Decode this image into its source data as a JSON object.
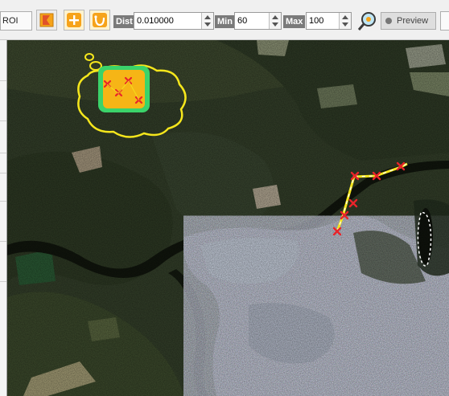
{
  "toolbar": {
    "roi_label": "ROI",
    "dist": {
      "label": "Dist",
      "value": "0.010000"
    },
    "min": {
      "label": "Min",
      "value": "60"
    },
    "max": {
      "label": "Max",
      "value": "100"
    },
    "preview_label": "Preview"
  },
  "icons": {
    "draw_roi": "orange-flag-roi-icon",
    "add": "plus-icon",
    "lasso": "lasso-icon",
    "zoom": "magnifier-zoom-icon",
    "preview": "radio-dot-icon",
    "thought_bubble": "thought-bubble-icon",
    "point_set": "x-points-icon"
  },
  "colors": {
    "accent_orange": "#f6a31a",
    "toolbar_bg": "#f0f0f0",
    "annotation_yellow": "#f5e61c",
    "marker_red": "#e8242a",
    "bubble_green": "#3bd36a"
  }
}
